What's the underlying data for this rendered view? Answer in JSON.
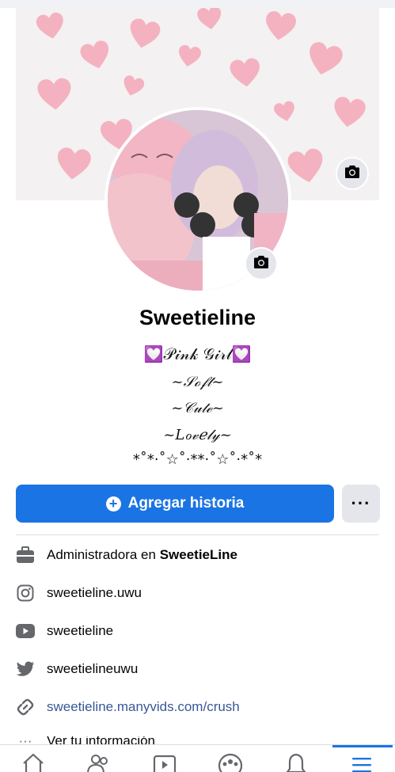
{
  "profile": {
    "name": "Sweetieline",
    "bio": [
      "💟𝒫𝒾𝓃𝓀 𝒢𝒾𝓇𝓁💟",
      "~𝒮ℴ𝒻𝓉~",
      "~𝒞𝓊𝓉ℯ~",
      "~𝐿ℴ𝓋ℯ𝓁𝓎~",
      "*˚*·˚☆˚·**·˚☆˚·*˚*"
    ]
  },
  "actions": {
    "add_story_label": "Agregar historia",
    "more_label": "···"
  },
  "info": {
    "work_prefix": "Administradora en ",
    "work_name": "SweetieLine",
    "instagram": "sweetieline.uwu",
    "youtube": "sweetieline",
    "twitter": "sweetielineuwu",
    "website": "sweetieline.manyvids.com/crush",
    "see_info": "Ver tu información"
  },
  "colors": {
    "accent": "#1b74e4",
    "link": "#385898",
    "heart": "#f4a3b3"
  },
  "icons": {
    "cover_camera": "camera-icon",
    "avatar_camera": "camera-icon",
    "work": "briefcase-icon",
    "instagram": "instagram-icon",
    "youtube": "youtube-icon",
    "twitter": "twitter-icon",
    "website": "link-icon",
    "nav": [
      "home-icon",
      "friends-icon",
      "watch-icon",
      "groups-icon",
      "notifications-icon",
      "menu-icon"
    ]
  }
}
